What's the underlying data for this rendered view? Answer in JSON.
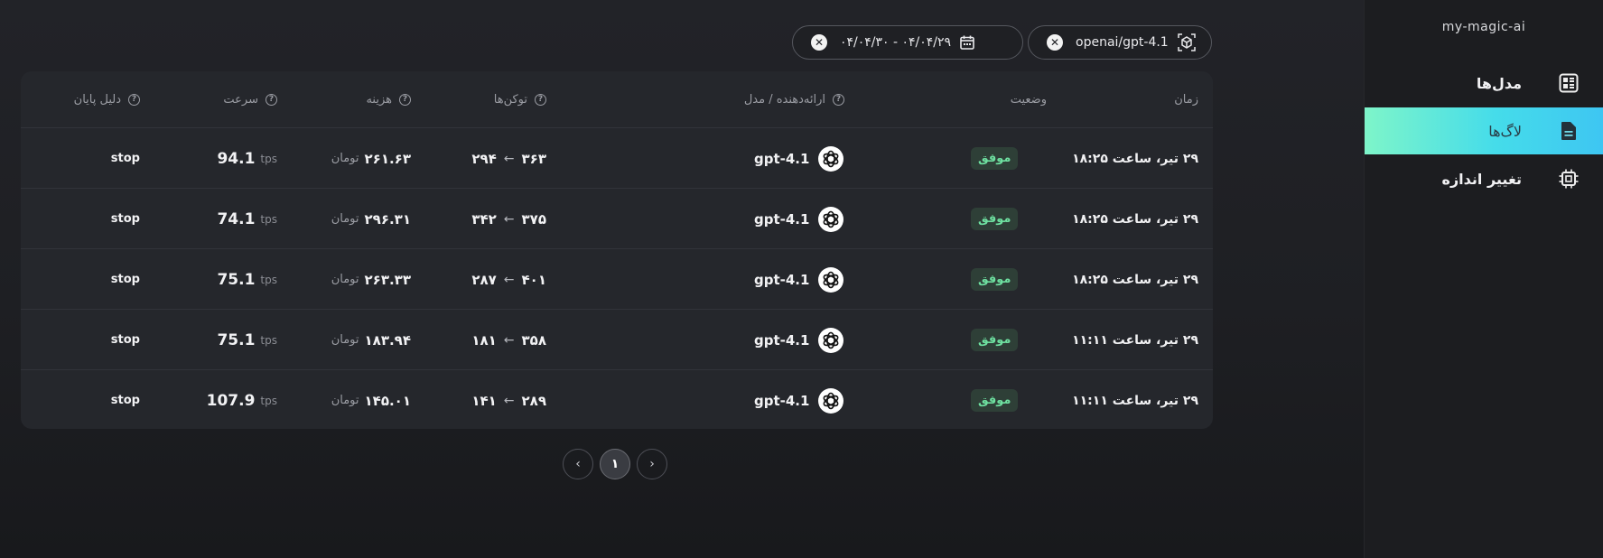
{
  "sidebar": {
    "brand": "my-magic-ai",
    "items": [
      {
        "label": "مدل‌ها",
        "icon": "models-grid-icon",
        "active": false
      },
      {
        "label": "لاگ‌ها",
        "icon": "document-icon",
        "active": true
      },
      {
        "label": "تغییر اندازه",
        "icon": "chip-icon",
        "active": false
      }
    ]
  },
  "filters": {
    "model_filter": "openai/gpt-4.1",
    "date_filter": "۰۴/۰۴/۳۰ - ۰۴/۰۴/۲۹"
  },
  "table": {
    "headers": {
      "time": "زمان",
      "status": "وضعیت",
      "provider_model": "ارائه‌دهنده / مدل",
      "tokens": "توکن‌ها",
      "cost": "هزینه",
      "speed": "سرعت",
      "finish_reason": "دلیل پایان"
    },
    "rows": [
      {
        "time": "۲۹ تیر، ساعت ۱۸:۲۵",
        "status": "موفق",
        "model": "gpt-4.1",
        "tokens_in": "۳۶۳",
        "tokens_out": "۲۹۴",
        "cost": "۲۶۱.۶۳",
        "cost_unit": "تومان",
        "speed": "94.1",
        "speed_unit": "tps",
        "finish_reason": "stop"
      },
      {
        "time": "۲۹ تیر، ساعت ۱۸:۲۵",
        "status": "موفق",
        "model": "gpt-4.1",
        "tokens_in": "۳۷۵",
        "tokens_out": "۳۴۲",
        "cost": "۲۹۶.۳۱",
        "cost_unit": "تومان",
        "speed": "74.1",
        "speed_unit": "tps",
        "finish_reason": "stop"
      },
      {
        "time": "۲۹ تیر، ساعت ۱۸:۲۵",
        "status": "موفق",
        "model": "gpt-4.1",
        "tokens_in": "۴۰۱",
        "tokens_out": "۲۸۷",
        "cost": "۲۶۳.۳۳",
        "cost_unit": "تومان",
        "speed": "75.1",
        "speed_unit": "tps",
        "finish_reason": "stop"
      },
      {
        "time": "۲۹ تیر، ساعت ۱۱:۱۱",
        "status": "موفق",
        "model": "gpt-4.1",
        "tokens_in": "۳۵۸",
        "tokens_out": "۱۸۱",
        "cost": "۱۸۳.۹۴",
        "cost_unit": "تومان",
        "speed": "75.1",
        "speed_unit": "tps",
        "finish_reason": "stop"
      },
      {
        "time": "۲۹ تیر، ساعت ۱۱:۱۱",
        "status": "موفق",
        "model": "gpt-4.1",
        "tokens_in": "۲۸۹",
        "tokens_out": "۱۴۱",
        "cost": "۱۴۵.۰۱",
        "cost_unit": "تومان",
        "speed": "107.9",
        "speed_unit": "tps",
        "finish_reason": "stop"
      }
    ]
  },
  "pagination": {
    "current": "۱"
  },
  "colors": {
    "accent_start": "#7ef5c9",
    "accent_end": "#3ec6f2",
    "success": "#6ee0a0"
  }
}
